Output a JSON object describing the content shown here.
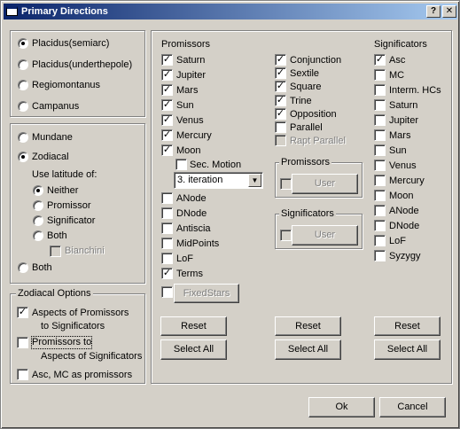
{
  "window": {
    "title": "Primary Directions",
    "help_glyph": "?",
    "close_glyph": "✕"
  },
  "methods": {
    "items": [
      {
        "label": "Placidus(semiarc)",
        "selected": true
      },
      {
        "label": "Placidus(underthepole)",
        "selected": false
      },
      {
        "label": "Regiomontanus",
        "selected": false
      },
      {
        "label": "Campanus",
        "selected": false
      }
    ]
  },
  "projection": {
    "mundane": "Mundane",
    "zodiacal": "Zodiacal",
    "latitude_label": "Use latitude of:",
    "neither": "Neither",
    "promissor": "Promissor",
    "significator": "Significator",
    "both_inner": "Both",
    "bianchini": "Bianchini",
    "both_outer": "Both"
  },
  "zodiacal_options": {
    "legend": "Zodiacal Options",
    "aspects_promissors_1": "Aspects of Promissors",
    "aspects_promissors_2": "to Significators",
    "promissors_to_1": "Promissors to",
    "promissors_to_2": "Aspects of Significators",
    "asc_mc": "Asc, MC as promissors"
  },
  "promissors": {
    "header": "Promissors",
    "items": [
      {
        "label": "Saturn",
        "checked": true
      },
      {
        "label": "Jupiter",
        "checked": true
      },
      {
        "label": "Mars",
        "checked": true
      },
      {
        "label": "Sun",
        "checked": true
      },
      {
        "label": "Venus",
        "checked": true
      },
      {
        "label": "Mercury",
        "checked": true
      },
      {
        "label": "Moon",
        "checked": true
      }
    ],
    "sec_motion": "Sec. Motion",
    "iteration_value": "3. iteration",
    "items2": [
      {
        "label": "ANode",
        "checked": false
      },
      {
        "label": "DNode",
        "checked": false
      },
      {
        "label": "Antiscia",
        "checked": false
      },
      {
        "label": "MidPoints",
        "checked": false
      },
      {
        "label": "LoF",
        "checked": false
      },
      {
        "label": "Terms",
        "checked": true
      }
    ],
    "fixedstars": "FixedStars"
  },
  "aspects": {
    "items": [
      {
        "label": "Conjunction",
        "checked": true
      },
      {
        "label": "Sextile",
        "checked": true
      },
      {
        "label": "Square",
        "checked": true
      },
      {
        "label": "Trine",
        "checked": true
      },
      {
        "label": "Opposition",
        "checked": true
      },
      {
        "label": "Parallel",
        "checked": false
      },
      {
        "label": "Rapt Parallel",
        "checked": false
      }
    ],
    "promissors_group": "Promissors",
    "significators_group": "Significators",
    "user": "User"
  },
  "significators": {
    "header": "Significators",
    "items": [
      {
        "label": "Asc",
        "checked": true
      },
      {
        "label": "MC",
        "checked": false
      },
      {
        "label": "Interm. HCs",
        "checked": false
      },
      {
        "label": "Saturn",
        "checked": false
      },
      {
        "label": "Jupiter",
        "checked": false
      },
      {
        "label": "Mars",
        "checked": false
      },
      {
        "label": "Sun",
        "checked": false
      },
      {
        "label": "Venus",
        "checked": false
      },
      {
        "label": "Mercury",
        "checked": false
      },
      {
        "label": "Moon",
        "checked": false
      },
      {
        "label": "ANode",
        "checked": false
      },
      {
        "label": "DNode",
        "checked": false
      },
      {
        "label": "LoF",
        "checked": false
      },
      {
        "label": "Syzygy",
        "checked": false
      }
    ]
  },
  "buttons": {
    "reset": "Reset",
    "select_all": "Select All",
    "ok": "Ok",
    "cancel": "Cancel"
  },
  "check_glyph": "✓",
  "arrow_glyph": "▼"
}
